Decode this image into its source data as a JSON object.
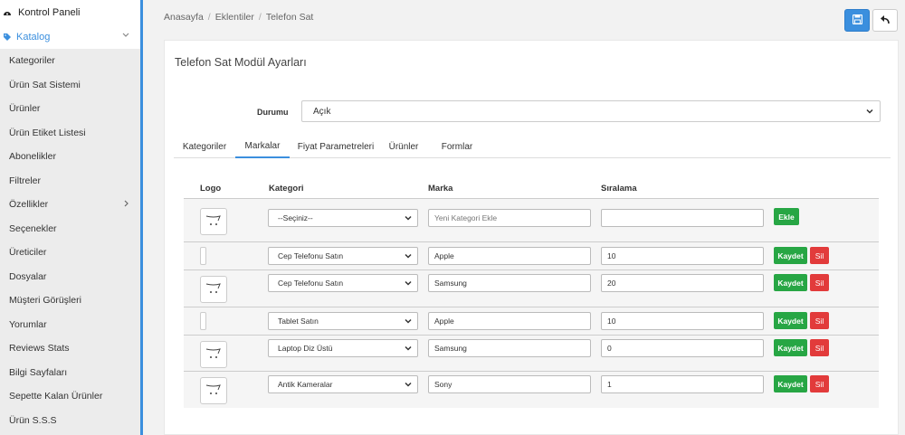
{
  "sidebar": {
    "top_item": "Kontrol Paneli",
    "category": "Katalog",
    "items": [
      {
        "label": "Kategoriler"
      },
      {
        "label": "Ürün Sat Sistemi"
      },
      {
        "label": "Ürünler"
      },
      {
        "label": "Ürün Etiket Listesi"
      },
      {
        "label": "Abonelikler"
      },
      {
        "label": "Filtreler"
      },
      {
        "label": "Özellikler"
      },
      {
        "label": "Seçenekler"
      },
      {
        "label": "Üreticiler"
      },
      {
        "label": "Dosyalar"
      },
      {
        "label": "Müşteri Görüşleri"
      },
      {
        "label": "Yorumlar"
      },
      {
        "label": "Reviews Stats"
      },
      {
        "label": "Bilgi Sayfaları"
      },
      {
        "label": "Sepette Kalan Ürünler"
      },
      {
        "label": "Ürün S.S.S"
      }
    ]
  },
  "breadcrumb": [
    "Anasayfa",
    "Eklentiler",
    "Telefon Sat"
  ],
  "panel": {
    "title": "Telefon Sat Modül Ayarları",
    "status_label": "Durumu",
    "status_value": "Açık"
  },
  "tabs": [
    "Kategoriler",
    "Markalar",
    "Fiyat Parametreleri",
    "Ürünler",
    "Formlar"
  ],
  "table": {
    "headers": {
      "logo": "Logo",
      "category": "Kategori",
      "brand": "Marka",
      "order": "Sıralama"
    },
    "new_row": {
      "category": "--Seçiniz--",
      "brand_placeholder": "Yeni Kategori Ekle",
      "order": "",
      "add_label": "Ekle"
    },
    "rows": [
      {
        "category": "Cep Telefonu Satın",
        "brand": "Apple",
        "order": "10"
      },
      {
        "category": "Cep Telefonu Satın",
        "brand": "Samsung",
        "order": "20"
      },
      {
        "category": "Tablet Satın",
        "brand": "Apple",
        "order": "10"
      },
      {
        "category": "Laptop Diz Üstü",
        "brand": "Samsung",
        "order": "0"
      },
      {
        "category": "Antik Kameralar",
        "brand": "Sony",
        "order": "1"
      }
    ],
    "save_label": "Kaydet",
    "delete_label": "Sil"
  },
  "colors": {
    "accent": "#3b8fde",
    "save": "#27a644",
    "delete": "#e23b3b"
  }
}
